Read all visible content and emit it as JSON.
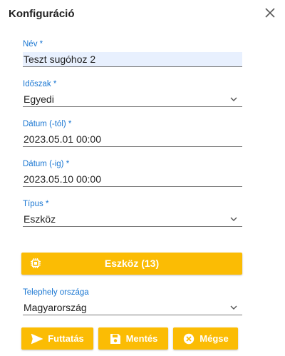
{
  "dialog": {
    "title": "Konfiguráció"
  },
  "fields": {
    "name": {
      "label": "Név *",
      "value": "Teszt sugóhoz 2"
    },
    "period": {
      "label": "Időszak *",
      "value": "Egyedi"
    },
    "date_from": {
      "label": "Dátum (-tól) *",
      "value": "2023.05.01 00:00"
    },
    "date_to": {
      "label": "Dátum (-ig) *",
      "value": "2023.05.10 00:00"
    },
    "type": {
      "label": "Típus *",
      "value": "Eszköz"
    },
    "country": {
      "label": "Telephely országa",
      "value": "Magyarország"
    }
  },
  "device_button": {
    "label": "Eszköz (13)"
  },
  "actions": {
    "run": "Futtatás",
    "save": "Mentés",
    "cancel": "Mégse"
  },
  "colors": {
    "accent": "#fbbc04",
    "label": "#1976d2",
    "filled_bg": "#e8f0fe"
  },
  "icons": [
    "close-icon",
    "chevron-down-icon",
    "chip-icon",
    "send-icon",
    "floppy-disk-icon",
    "cancel-circle-icon"
  ]
}
